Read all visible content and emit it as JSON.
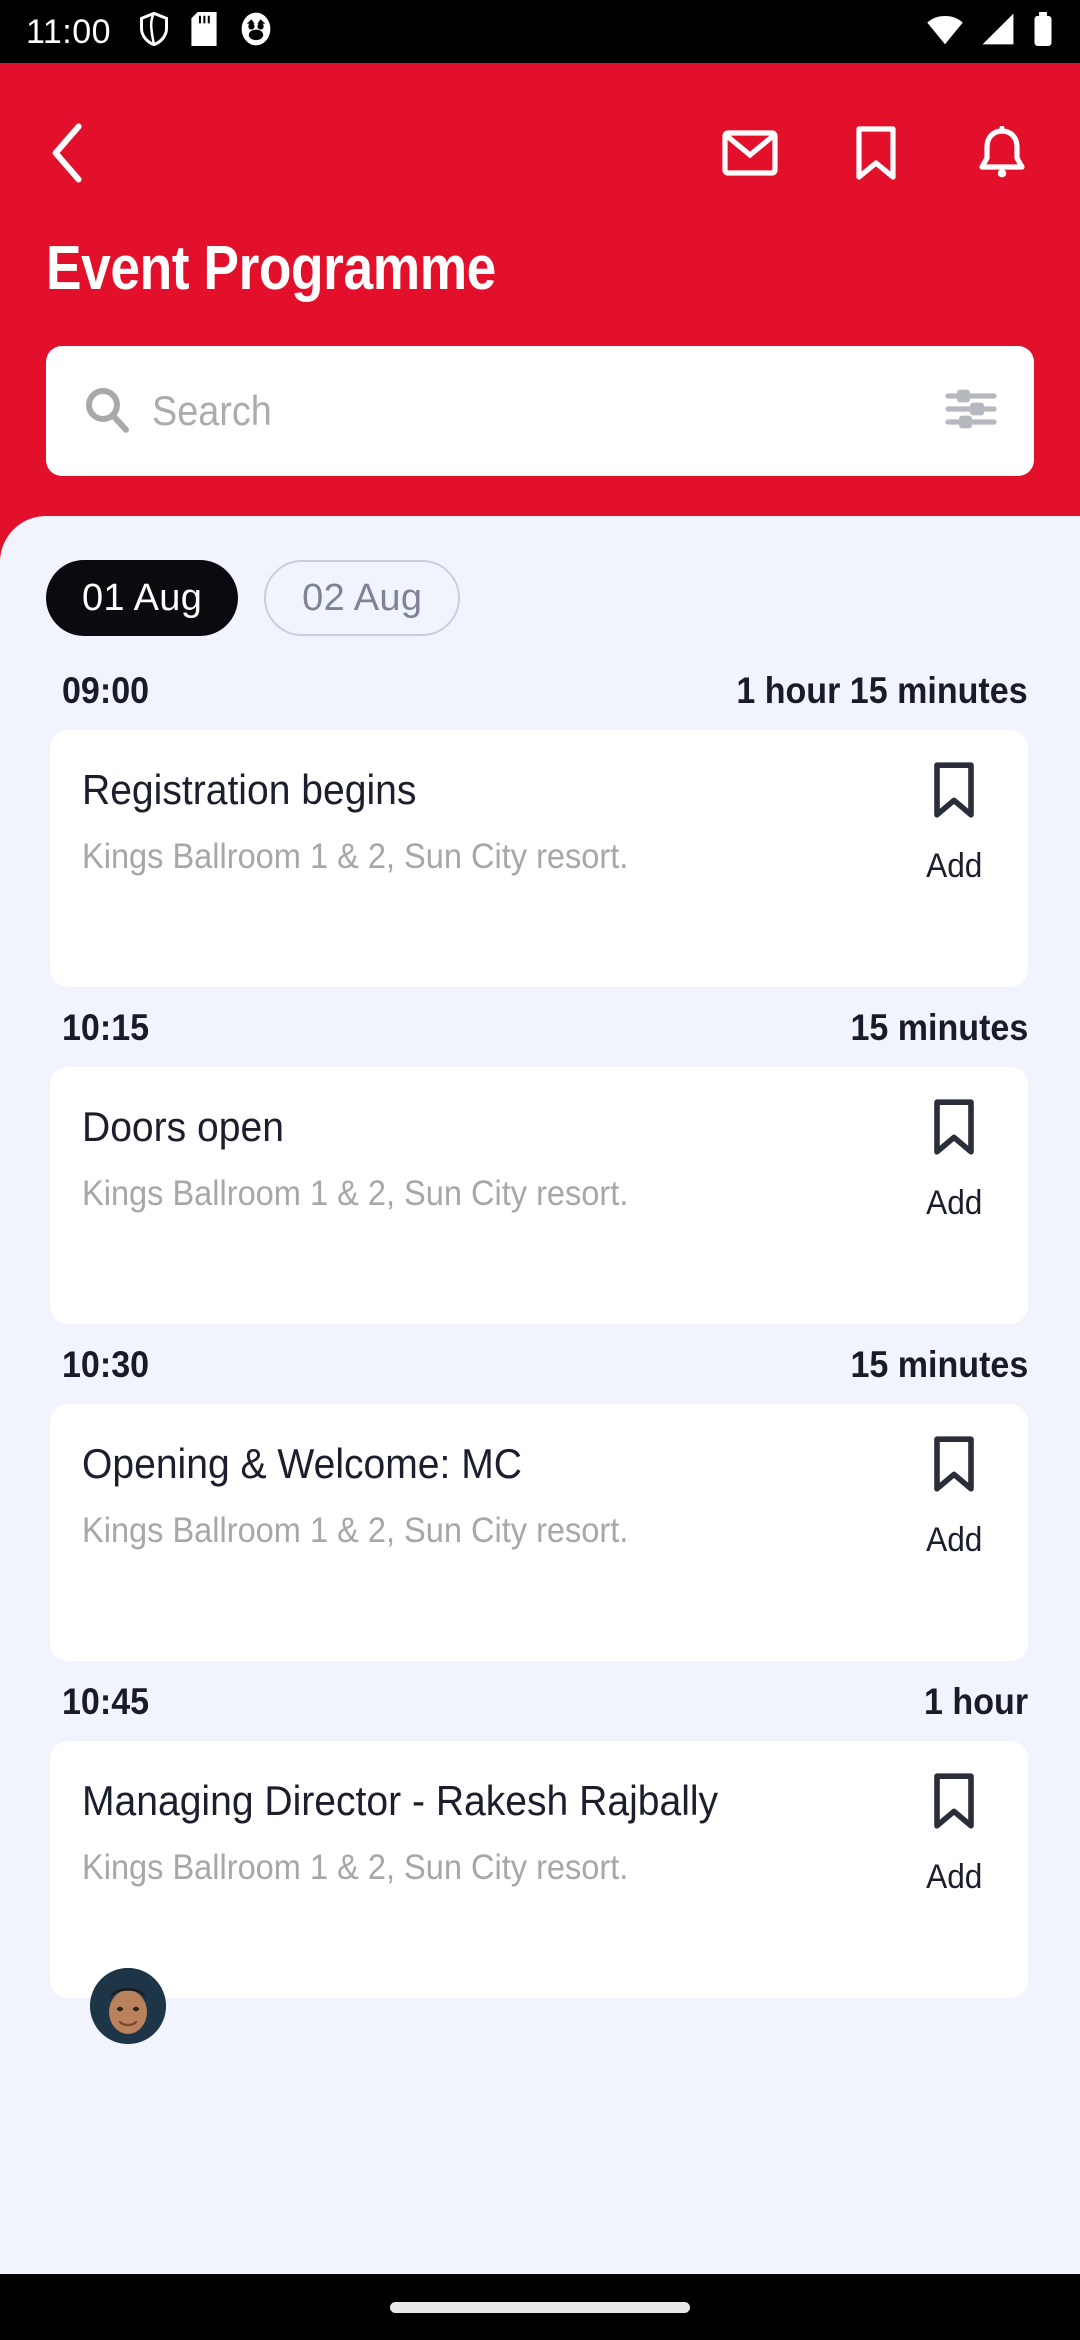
{
  "status_bar": {
    "time": "11:00",
    "left_icons": [
      "shield-icon",
      "sd-card-icon",
      "owl-face-icon"
    ],
    "right_icons": [
      "wifi-icon",
      "cellular-signal-icon",
      "battery-icon"
    ]
  },
  "header": {
    "back_icon": "chevron-left-icon",
    "title": "Event Programme",
    "accent_color": "#E2102A",
    "actions": [
      {
        "name": "mail-icon",
        "label": "Mail"
      },
      {
        "name": "bookmark-icon",
        "label": "Bookmarks"
      },
      {
        "name": "bell-icon",
        "label": "Notifications"
      }
    ]
  },
  "search": {
    "placeholder": "Search",
    "value": "",
    "search_icon": "search-icon",
    "filter_icon": "filter-sliders-icon"
  },
  "tabs": [
    {
      "label": "01 Aug",
      "active": true
    },
    {
      "label": "02 Aug",
      "active": false
    }
  ],
  "sessions": [
    {
      "time": "09:00",
      "duration": "1 hour 15 minutes",
      "title": "Registration begins",
      "location": "Kings Ballroom 1 & 2, Sun City resort.",
      "action_label": "Add",
      "has_avatar": false
    },
    {
      "time": "10:15",
      "duration": "15 minutes",
      "title": "Doors open",
      "location": "Kings Ballroom 1 & 2, Sun City resort.",
      "action_label": "Add",
      "has_avatar": false
    },
    {
      "time": "10:30",
      "duration": "15 minutes",
      "title": "Opening & Welcome: MC",
      "location": "Kings Ballroom 1 & 2, Sun City resort.",
      "action_label": "Add",
      "has_avatar": false
    },
    {
      "time": "10:45",
      "duration": "1 hour",
      "title": "Managing Director - Rakesh Rajbally",
      "location": "Kings Ballroom 1 & 2, Sun City resort.",
      "action_label": "Add",
      "has_avatar": true
    }
  ],
  "colors": {
    "brand_red": "#E2102A",
    "content_bg": "#F1F4FD",
    "card_bg": "#FFFFFF",
    "active_tab_bg": "#0B0B0F",
    "muted_text": "#A7A7AB"
  },
  "nav_bar": {
    "home_indicator": "home-indicator"
  }
}
